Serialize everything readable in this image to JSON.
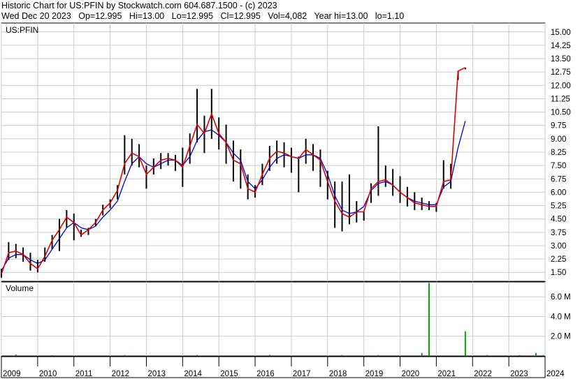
{
  "header": {
    "line1": "Historic Chart for US:PFIN by Stockwatch.com 604.687.1500 - (c) 2023",
    "line2": "Wed Dec 20 2023   Op=12.995   Hi=13.00   Lo=12.995   Cl=12.995   Vol=4,082   Year hi=13.00   lo=1.10"
  },
  "colors": {
    "price_bars": "#000000",
    "ma_short": "#e00000",
    "ma_long": "#0000cc",
    "spike_line": "#ff00ff",
    "volume_bars": "#00aa00",
    "grid": "#cccccc"
  },
  "chart_data": [
    {
      "type": "line",
      "panel_label": "US:PFIN",
      "ylim": [
        1.0,
        15.5
      ],
      "y_ticks": [
        1.5,
        2.25,
        3.0,
        3.75,
        4.5,
        5.25,
        6.0,
        6.75,
        7.5,
        8.25,
        9.0,
        9.75,
        10.5,
        11.25,
        12.0,
        12.75,
        13.5,
        14.25,
        15.0
      ],
      "y_tick_labels": [
        "1.50",
        "2.25",
        "3.00",
        "3.75",
        "4.50",
        "5.25",
        "6.00",
        "6.75",
        "7.50",
        "8.25",
        "9.00",
        "9.75",
        "10.50",
        "11.25",
        "12.00",
        "12.75",
        "13.50",
        "14.25",
        "15.00"
      ],
      "xlim": [
        2009.0,
        2024.0
      ],
      "x_ticks": [
        2009,
        2010,
        2011,
        2012,
        2013,
        2014,
        2015,
        2016,
        2017,
        2018,
        2019,
        2020,
        2021,
        2022,
        2023,
        2024
      ],
      "x_tick_labels": [
        "2009",
        "2010",
        "2011",
        "2012",
        "2013",
        "2014",
        "2015",
        "2016",
        "2017",
        "2018",
        "2019",
        "2020",
        "2021",
        "2022",
        "2023",
        "2024"
      ],
      "grid": true,
      "x": [
        2009.0,
        2009.2,
        2009.4,
        2009.6,
        2009.8,
        2010.0,
        2010.2,
        2010.4,
        2010.6,
        2010.8,
        2011.0,
        2011.2,
        2011.4,
        2011.6,
        2011.8,
        2012.0,
        2012.2,
        2012.4,
        2012.6,
        2012.8,
        2013.0,
        2013.2,
        2013.4,
        2013.6,
        2013.8,
        2014.0,
        2014.2,
        2014.4,
        2014.6,
        2014.8,
        2015.0,
        2015.2,
        2015.4,
        2015.6,
        2015.8,
        2016.0,
        2016.2,
        2016.4,
        2016.6,
        2016.8,
        2017.0,
        2017.2,
        2017.4,
        2017.6,
        2017.8,
        2018.0,
        2018.2,
        2018.4,
        2018.6,
        2018.8,
        2019.0,
        2019.2,
        2019.4,
        2019.6,
        2019.8,
        2020.0,
        2020.2,
        2020.4,
        2020.6,
        2020.8,
        2021.0,
        2021.2,
        2021.4,
        2021.6,
        2021.8,
        2022.0,
        2022.2,
        2022.4,
        2022.6,
        2022.8,
        2023.0,
        2023.2,
        2023.4,
        2023.6,
        2023.7,
        2023.75,
        2023.8,
        2023.85,
        2023.9,
        2023.97
      ],
      "series": [
        {
          "kind": "price_range",
          "high": [
            1.7,
            3.2,
            3.1,
            2.9,
            2.6,
            2.2,
            2.9,
            3.6,
            4.5,
            5.0,
            4.8,
            3.9,
            4.0,
            4.5,
            5.3,
            5.6,
            6.4,
            9.2,
            9.0,
            8.7,
            7.5,
            7.9,
            8.2,
            8.2,
            8.1,
            8.5,
            9.3,
            11.8,
            10.3,
            11.8,
            10.2,
            9.8,
            8.9,
            8.4,
            7.0,
            6.4,
            7.6,
            8.6,
            8.9,
            8.8,
            8.5,
            8.0,
            9.0,
            8.7,
            8.4,
            7.2,
            6.6,
            6.6,
            7.0,
            5.5,
            4.9,
            6.5,
            9.7,
            7.5,
            7.3,
            6.9,
            6.3,
            6.0,
            5.7,
            5.5,
            5.4,
            7.8,
            7.6,
            12.8,
            13.0
          ],
          "low": [
            1.2,
            2.2,
            2.3,
            2.1,
            1.6,
            1.5,
            2.1,
            2.8,
            2.7,
            4.0,
            3.3,
            3.5,
            3.6,
            4.1,
            4.7,
            5.1,
            5.6,
            7.0,
            7.5,
            7.4,
            6.2,
            7.0,
            7.3,
            7.5,
            7.2,
            6.3,
            7.6,
            8.8,
            8.2,
            9.0,
            8.4,
            7.6,
            6.6,
            6.2,
            5.6,
            5.7,
            6.4,
            7.2,
            7.6,
            7.4,
            7.1,
            6.0,
            7.6,
            7.2,
            6.3,
            5.6,
            4.0,
            3.8,
            4.2,
            4.3,
            4.4,
            5.4,
            5.8,
            6.3,
            5.8,
            5.4,
            5.2,
            5.0,
            5.0,
            5.0,
            4.9,
            6.2,
            6.2,
            12.3,
            12.9
          ]
        },
        {
          "kind": "moving_average_short",
          "values": [
            1.4,
            2.6,
            2.7,
            2.5,
            2.0,
            1.7,
            2.4,
            3.3,
            3.9,
            4.6,
            4.3,
            3.6,
            3.9,
            4.3,
            5.0,
            5.4,
            6.1,
            7.6,
            8.2,
            8.0,
            7.0,
            7.4,
            7.8,
            7.9,
            7.8,
            7.4,
            8.6,
            9.8,
            9.3,
            10.4,
            9.3,
            8.8,
            7.8,
            7.6,
            6.2,
            6.0,
            7.0,
            7.9,
            8.3,
            8.2,
            8.0,
            7.9,
            8.4,
            8.1,
            7.8,
            6.6,
            5.5,
            4.8,
            4.6,
            4.9,
            4.9,
            6.2,
            6.6,
            6.7,
            6.4,
            6.0,
            5.7,
            5.4,
            5.3,
            5.2,
            5.2,
            6.6,
            6.7,
            12.8,
            13.0
          ]
        },
        {
          "kind": "moving_average_long",
          "values": [
            1.6,
            2.3,
            2.5,
            2.5,
            2.2,
            2.0,
            2.2,
            2.8,
            3.4,
            4.0,
            4.3,
            4.0,
            3.9,
            4.1,
            4.6,
            5.0,
            5.5,
            6.6,
            7.6,
            8.0,
            7.6,
            7.4,
            7.6,
            7.8,
            7.8,
            7.5,
            8.0,
            8.9,
            9.4,
            9.5,
            9.2,
            8.8,
            8.2,
            7.8,
            6.6,
            6.2,
            6.7,
            7.4,
            7.9,
            8.1,
            8.0,
            7.9,
            8.1,
            8.1,
            7.9,
            7.0,
            5.8,
            5.0,
            4.8,
            4.9,
            5.2,
            6.1,
            6.5,
            6.6,
            6.4,
            6.0,
            5.7,
            5.5,
            5.4,
            5.3,
            5.3,
            6.3,
            6.6,
            8.5,
            10.0
          ]
        }
      ]
    },
    {
      "type": "bar",
      "panel_label": "Volume",
      "ylim": [
        0,
        7.5
      ],
      "y_ticks": [
        2.0,
        4.0,
        6.0
      ],
      "y_tick_labels": [
        "2.0 M",
        "4.0 M",
        "6.0 M"
      ],
      "x": [
        2009.4,
        2010.4,
        2012.4,
        2014.4,
        2016.4,
        2018.4,
        2019.4,
        2020.6,
        2020.8,
        2021.8,
        2022.4,
        2023.3,
        2023.75,
        2023.95
      ],
      "values": [
        0.15,
        0.08,
        0.1,
        0.1,
        0.12,
        0.1,
        0.1,
        0.3,
        7.4,
        2.5,
        0.1,
        0.1,
        0.3,
        0.1
      ]
    }
  ]
}
